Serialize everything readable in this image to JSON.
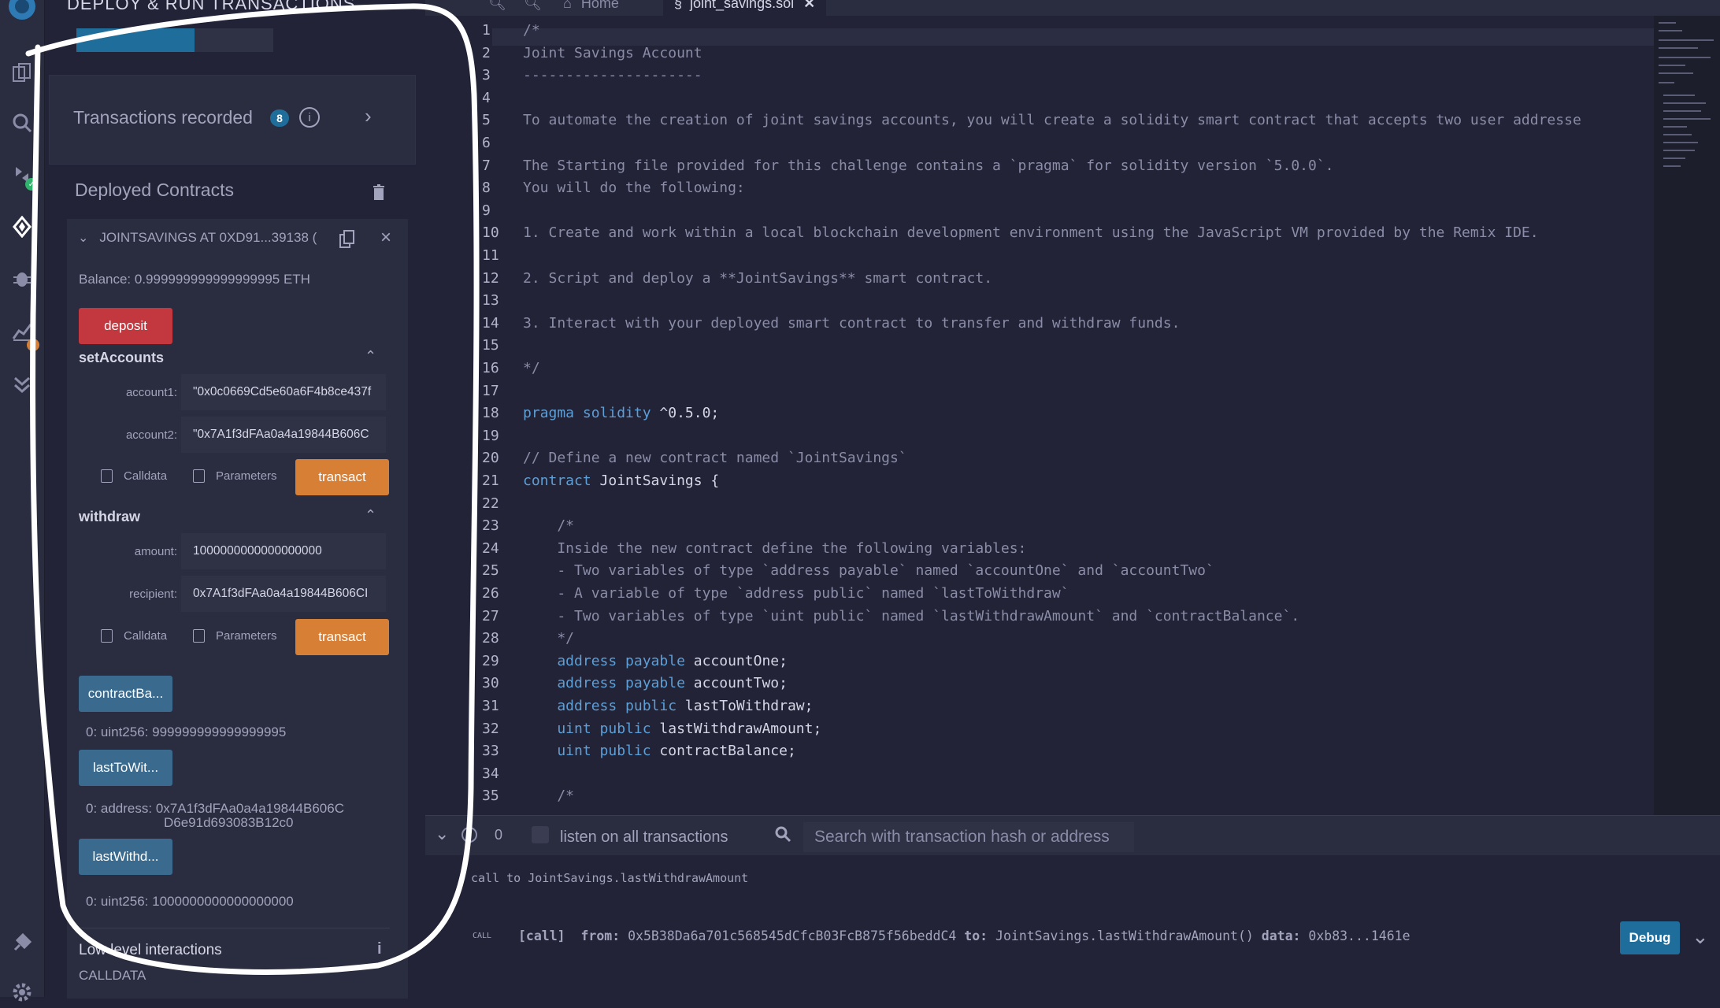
{
  "side_panel": {
    "title": "DEPLOY & RUN TRANSACTIONS",
    "transactions_label": "Transactions recorded",
    "transactions_count": "8",
    "deployed_label": "Deployed Contracts",
    "instance": {
      "name": "JOINTSAVINGS AT 0XD91...39138 (",
      "balance": "Balance: 0.999999999999999995 ETH",
      "deposit_label": "deposit",
      "setAccounts": {
        "title": "setAccounts",
        "account1_label": "account1:",
        "account1_value": "\"0x0c0669Cd5e60a6F4b8ce437f",
        "account2_label": "account2:",
        "account2_value": "\"0x7A1f3dFAa0a4a19844B606C",
        "calldata_label": "Calldata",
        "parameters_label": "Parameters",
        "transact_label": "transact"
      },
      "withdraw": {
        "title": "withdraw",
        "amount_label": "amount:",
        "amount_value": "1000000000000000000",
        "recipient_label": "recipient:",
        "recipient_value": "0x7A1f3dFAa0a4a19844B606CI",
        "calldata_label": "Calldata",
        "parameters_label": "Parameters",
        "transact_label": "transact"
      },
      "getters": [
        {
          "label": "contractBa...",
          "output": "0: uint256: 999999999999999995"
        },
        {
          "label": "lastToWit...",
          "output": "0: address: 0x7A1f3dFAa0a4a19844B606C",
          "output2": "D6e91d693083B12c0"
        },
        {
          "label": "lastWithd...",
          "output": "0: uint256: 1000000000000000000"
        }
      ],
      "low_level_label": "Low level interactions",
      "calldata_caption": "CALLDATA"
    }
  },
  "tabs": {
    "home": "Home",
    "file": "joint_savings.sol"
  },
  "editor": {
    "lines": [
      {
        "n": "1",
        "t": "/*",
        "c": "cm"
      },
      {
        "n": "2",
        "t": "Joint Savings Account",
        "c": "cm"
      },
      {
        "n": "3",
        "t": "---------------------",
        "c": "cm"
      },
      {
        "n": "4",
        "t": "",
        "c": "cm"
      },
      {
        "n": "5",
        "t": "To automate the creation of joint savings accounts, you will create a solidity smart contract that accepts two user addresse",
        "c": "cm"
      },
      {
        "n": "6",
        "t": "",
        "c": "cm"
      },
      {
        "n": "7",
        "t": "The Starting file provided for this challenge contains a `pragma` for solidity version `5.0.0`.",
        "c": "cm"
      },
      {
        "n": "8",
        "t": "You will do the following:",
        "c": "cm"
      },
      {
        "n": "9",
        "t": "",
        "c": "cm"
      },
      {
        "n": "10",
        "t": "1. Create and work within a local blockchain development environment using the JavaScript VM provided by the Remix IDE.",
        "c": "cm"
      },
      {
        "n": "11",
        "t": "",
        "c": "cm"
      },
      {
        "n": "12",
        "t": "2. Script and deploy a **JointSavings** smart contract.",
        "c": "cm"
      },
      {
        "n": "13",
        "t": "",
        "c": "cm"
      },
      {
        "n": "14",
        "t": "3. Interact with your deployed smart contract to transfer and withdraw funds.",
        "c": "cm"
      },
      {
        "n": "15",
        "t": "",
        "c": "cm"
      },
      {
        "n": "16",
        "t": "*/",
        "c": "cm"
      },
      {
        "n": "17",
        "t": "",
        "c": ""
      },
      {
        "n": "18",
        "k": "pragma solidity",
        "t": " ^0.5.0;",
        "c": ""
      },
      {
        "n": "19",
        "t": "",
        "c": ""
      },
      {
        "n": "20",
        "t": "// Define a new contract named `JointSavings`",
        "c": "cm"
      },
      {
        "n": "21",
        "k": "contract",
        "t": " JointSavings {",
        "c": ""
      },
      {
        "n": "22",
        "t": "",
        "c": ""
      },
      {
        "n": "23",
        "t": "    /*",
        "c": "cm"
      },
      {
        "n": "24",
        "t": "    Inside the new contract define the following variables:",
        "c": "cm"
      },
      {
        "n": "25",
        "t": "    - Two variables of type `address payable` named `accountOne` and `accountTwo`",
        "c": "cm"
      },
      {
        "n": "26",
        "t": "    - A variable of type `address public` named `lastToWithdraw`",
        "c": "cm"
      },
      {
        "n": "27",
        "t": "    - Two variables of type `uint public` named `lastWithdrawAmount` and `contractBalance`.",
        "c": "cm"
      },
      {
        "n": "28",
        "t": "    */",
        "c": "cm"
      },
      {
        "n": "29",
        "k": "    address payable",
        "t": " accountOne;",
        "c": ""
      },
      {
        "n": "30",
        "k": "    address payable",
        "t": " accountTwo;",
        "c": ""
      },
      {
        "n": "31",
        "k": "    address public",
        "t": " lastToWithdraw;",
        "c": ""
      },
      {
        "n": "32",
        "k": "    uint public",
        "t": " lastWithdrawAmount;",
        "c": ""
      },
      {
        "n": "33",
        "k": "    uint public",
        "t": " contractBalance;",
        "c": ""
      },
      {
        "n": "34",
        "t": "",
        "c": ""
      },
      {
        "n": "35",
        "t": "    /*",
        "c": "cm"
      }
    ]
  },
  "terminal": {
    "count": "0",
    "listen_label": "listen on all transactions",
    "search_placeholder": "Search with transaction hash or address",
    "log_line": "call to JointSavings.lastWithdrawAmount",
    "call_tag": "CALL",
    "call_kind": "[call]",
    "from_label": "from:",
    "from_value": "0x5B38Da6a701c568545dCfcB03FcB875f56beddC4",
    "to_label": "to:",
    "to_value": "JointSavings.lastWithdrawAmount()",
    "data_label": "data:",
    "data_value": "0xb83...1461e",
    "debug_label": "Debug"
  },
  "colors": {
    "background": "#222336",
    "panel": "#2a2c3f",
    "accent_blue": "#1f6d9b",
    "deposit_red": "#c2383e",
    "transact_orange": "#d77f35",
    "getter_blue": "#3a6a8d",
    "annotation": "#ffffff"
  }
}
